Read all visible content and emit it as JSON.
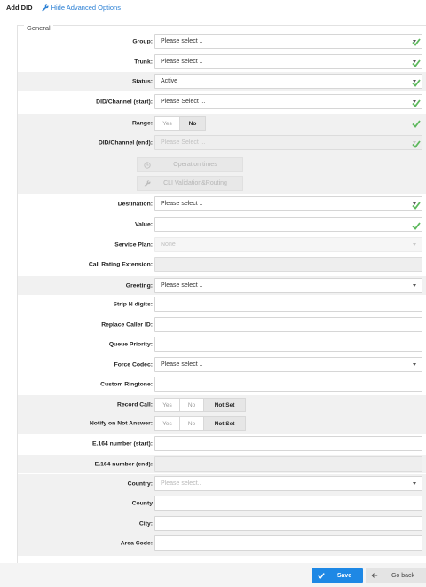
{
  "header": {
    "title": "Add DID",
    "toggle_label": "Hide Advanced Options"
  },
  "section": {
    "legend": "General"
  },
  "fields": {
    "group": {
      "label": "Group:",
      "value": "Please select .."
    },
    "trunk": {
      "label": "Trunk:",
      "value": "Please select .."
    },
    "status": {
      "label": "Status:",
      "value": "Active"
    },
    "did_start": {
      "label": "DID/Channel (start):",
      "value": "Please Select ..."
    },
    "range": {
      "label": "Range:",
      "options": [
        "Yes",
        "No"
      ],
      "selected": "No"
    },
    "did_end": {
      "label": "DID/Channel (end):",
      "value": "Please Select ..."
    },
    "operation_times": {
      "label": "Operation times"
    },
    "cli_validation": {
      "label": "CLI Validation&Routing"
    },
    "destination": {
      "label": "Destination:",
      "value": "Please select .."
    },
    "value": {
      "label": "Value:",
      "value": ""
    },
    "service_plan": {
      "label": "Service Plan:",
      "value": "None"
    },
    "call_rating_extension": {
      "label": "Call Rating Extension:",
      "value": ""
    },
    "greeting": {
      "label": "Greeting:",
      "value": "Please select .."
    },
    "strip_n_digits": {
      "label": "Strip N digits:",
      "value": ""
    },
    "replace_caller_id": {
      "label": "Replace Caller ID:",
      "value": ""
    },
    "queue_priority": {
      "label": "Queue Priority:",
      "value": ""
    },
    "force_codec": {
      "label": "Force Codec:",
      "value": "Please select .."
    },
    "custom_ringtone": {
      "label": "Custom Ringtone:",
      "value": ""
    },
    "record_call": {
      "label": "Record Call:",
      "options": [
        "Yes",
        "No",
        "Not Set"
      ],
      "selected": "Not Set"
    },
    "notify_on_not_answer": {
      "label": "Notify on Not Answer:",
      "options": [
        "Yes",
        "No",
        "Not Set"
      ],
      "selected": "Not Set"
    },
    "e164_start": {
      "label": "E.164 number (start):",
      "value": ""
    },
    "e164_end": {
      "label": "E.164 number (end):",
      "value": ""
    },
    "country": {
      "label": "Country:",
      "value": "Please select.."
    },
    "county": {
      "label": "County",
      "value": ""
    },
    "city": {
      "label": "City:",
      "value": ""
    },
    "area_code": {
      "label": "Area Code:",
      "value": ""
    }
  },
  "footer": {
    "save_label": "Save",
    "back_label": "Go back"
  },
  "icons": {
    "check": "check-icon",
    "wrench": "wrench-icon",
    "clock": "clock-icon",
    "caret": "caret-down-icon",
    "arrow_left": "arrow-left-icon"
  },
  "colors": {
    "accent": "#1e88e5",
    "link": "#2a7fd4",
    "valid": "#5cb85c"
  }
}
